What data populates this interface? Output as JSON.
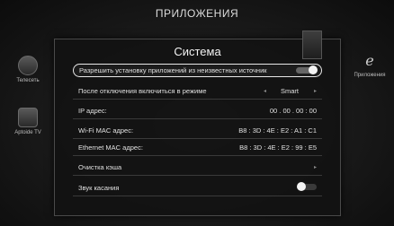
{
  "screen": {
    "title": "ПРИЛОЖЕНИЯ"
  },
  "side_apps": [
    {
      "label": "Телесеть",
      "icon": "app-tile-icon"
    },
    {
      "label": "Aptoide TV",
      "icon": "app-tile-icon"
    },
    {
      "label": "Приложения",
      "icon": "e-logo-icon"
    }
  ],
  "dialog": {
    "title": "Система",
    "rows": {
      "unknown_sources": {
        "label": "Разрешить установку приложений из неизвестных источник",
        "state": "on"
      },
      "power_mode": {
        "label": "После отключения включиться в режиме",
        "value": "Smart"
      },
      "ip": {
        "label": "IP адрес:",
        "value": "00 . 00 . 00 : 00"
      },
      "wifi_mac": {
        "label": "Wi-Fi MAC адрес:",
        "value": "B8 : 3D : 4E : E2 : A1 : C1"
      },
      "eth_mac": {
        "label": "Ethernet MAC адрес:",
        "value": "B8 : 3D : 4E : E2 : 99 : E5"
      },
      "clear_cache": {
        "label": "Очистка кэша"
      },
      "touch_sound": {
        "label": "Звук касания",
        "state": "off"
      }
    }
  },
  "colors": {
    "focus_border": "#e8e8e8",
    "panel_bg": "#121212",
    "toggle_knob": "#f4f4f4"
  }
}
